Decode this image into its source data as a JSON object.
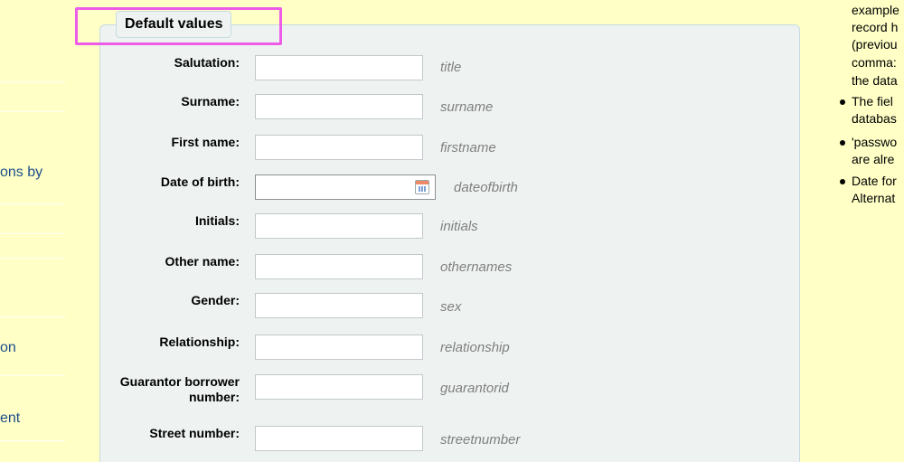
{
  "sidebar": {
    "items": [
      {
        "label": "ons by"
      },
      {
        "label": "on"
      },
      {
        "label": "ent"
      }
    ]
  },
  "fieldset": {
    "legend": "Default values",
    "rows": [
      {
        "label": "Salutation:",
        "hint": "title",
        "value": ""
      },
      {
        "label": "Surname:",
        "hint": "surname",
        "value": ""
      },
      {
        "label": "First name:",
        "hint": "firstname",
        "value": ""
      },
      {
        "label": "Date of birth:",
        "hint": "dateofbirth",
        "value": ""
      },
      {
        "label": "Initials:",
        "hint": "initials",
        "value": ""
      },
      {
        "label": "Other name:",
        "hint": "othernames",
        "value": ""
      },
      {
        "label": "Gender:",
        "hint": "sex",
        "value": ""
      },
      {
        "label": "Relationship:",
        "hint": "relationship",
        "value": ""
      },
      {
        "label": "Guarantor borrower number:",
        "hint": "guarantorid",
        "value": ""
      },
      {
        "label": "Street number:",
        "hint": "streetnumber",
        "value": ""
      }
    ]
  },
  "help": {
    "lines": [
      "example",
      "record h",
      "(previou",
      "comma:",
      "the data",
      "The fiel",
      "databas",
      "'passwo",
      "are alre",
      "Date for",
      "Alternat"
    ]
  },
  "colors": {
    "page_bg": "#ffffc6",
    "fieldset_bg": "#eef3f1",
    "highlight": "#ec5ce8"
  }
}
